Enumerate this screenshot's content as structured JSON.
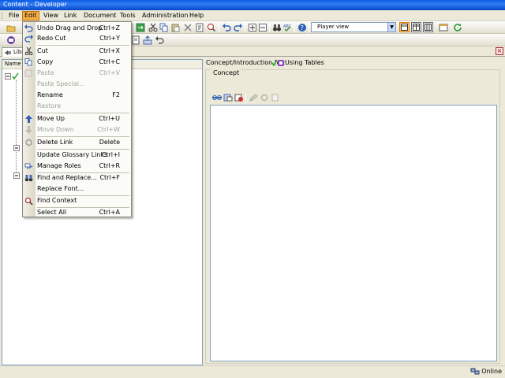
{
  "window": {
    "title": "Content - Developer"
  },
  "menubar": {
    "items": [
      {
        "label": "File"
      },
      {
        "label": "Edit"
      },
      {
        "label": "View"
      },
      {
        "label": "Link"
      },
      {
        "label": "Document"
      },
      {
        "label": "Tools"
      },
      {
        "label": "Administration"
      },
      {
        "label": "Help"
      }
    ]
  },
  "toolbar": {
    "player_select": "Player view"
  },
  "left_panel": {
    "tab_label": "Libr",
    "column_name": "Name"
  },
  "right_panel": {
    "intro_label": "Concept/Introduction for:",
    "intro_title": "Using Tables",
    "concept_label": "Concept"
  },
  "status": {
    "connection": "Online"
  },
  "edit_menu": {
    "undo": {
      "label": "Undo Drag and Drop",
      "shortcut": "Ctrl+Z"
    },
    "redo": {
      "label": "Redo Cut",
      "shortcut": "Ctrl+Y"
    },
    "cut": {
      "label": "Cut",
      "shortcut": "Ctrl+X"
    },
    "copy": {
      "label": "Copy",
      "shortcut": "Ctrl+C"
    },
    "paste": {
      "label": "Paste",
      "shortcut": "Ctrl+V"
    },
    "paste_special": {
      "label": "Paste Special..."
    },
    "rename": {
      "label": "Rename",
      "shortcut": "F2"
    },
    "restore": {
      "label": "Restore"
    },
    "move_up": {
      "label": "Move Up",
      "shortcut": "Ctrl+U"
    },
    "move_down": {
      "label": "Move Down",
      "shortcut": "Ctrl+W"
    },
    "delete_link": {
      "label": "Delete Link",
      "shortcut": "Delete"
    },
    "update_glossary": {
      "label": "Update Glossary Links",
      "shortcut": "Ctrl+I"
    },
    "manage_roles": {
      "label": "Manage Roles",
      "shortcut": "Ctrl+R"
    },
    "find_replace": {
      "label": "Find and Replace...",
      "shortcut": "Ctrl+F"
    },
    "replace_font": {
      "label": "Replace Font..."
    },
    "find_context": {
      "label": "Find Context"
    },
    "select_all": {
      "label": "Select All",
      "shortcut": "Ctrl+A"
    }
  },
  "colors": {
    "accent": "#f8b148",
    "title_bar": "#0a5ce4",
    "check_green": "#2fa82f"
  }
}
